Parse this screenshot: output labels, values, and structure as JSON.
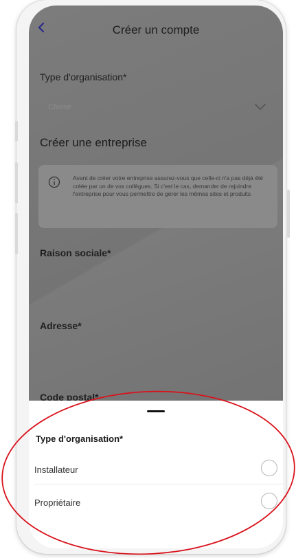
{
  "header": {
    "back_icon": "chevron-left-icon",
    "title": "Créer un compte"
  },
  "form": {
    "org_type_label": "Type d'organisation*",
    "org_type_placeholder": "Choisir",
    "section_title": "Créer une entreprise",
    "info_icon": "info-circle-icon",
    "info_text": "Avant de créer votre entreprise assurez-vous que celle-ci n'a pas déjà été créée par un de vos collègues. Si c'est le cas, demander de rejoindre l'entreprise pour vous permettre de gérer les mêmes sites et produits",
    "raison_sociale_label": "Raison sociale*",
    "adresse_label": "Adresse*",
    "code_postal_label": "Code postal*"
  },
  "sheet": {
    "title": "Type d'organisation*",
    "options": [
      {
        "label": "Installateur",
        "selected": false
      },
      {
        "label": "Propriétaire",
        "selected": false
      }
    ]
  },
  "colors": {
    "annotation": "#d9121b",
    "overlay": "#777777"
  }
}
